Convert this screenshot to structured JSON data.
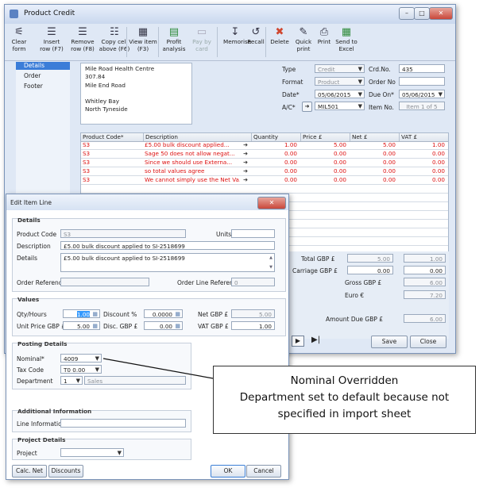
{
  "main_window": {
    "title": "Product Credit",
    "toolbar": [
      {
        "label": "Clear\nform",
        "icon": "broom-icon"
      },
      {
        "label": "Insert\nrow (F7)",
        "icon": "insert-row-icon"
      },
      {
        "label": "Remove\nrow (F8)",
        "icon": "remove-row-icon"
      },
      {
        "label": "Copy cell\nabove (F6)",
        "icon": "copy-cell-icon"
      },
      {
        "label": "View item\n(F3)",
        "icon": "view-item-icon"
      },
      {
        "label": "Profit\nanalysis",
        "icon": "profit-icon"
      },
      {
        "label": "Pay by\ncard",
        "icon": "card-icon",
        "disabled": true
      },
      {
        "label": "Memorise",
        "icon": "memorise-icon"
      },
      {
        "label": "Recall",
        "icon": "recall-icon"
      },
      {
        "label": "Delete",
        "icon": "delete-icon"
      },
      {
        "label": "Quick\nprint",
        "icon": "quick-print-icon"
      },
      {
        "label": "Print",
        "icon": "print-icon"
      },
      {
        "label": "Send to\nExcel",
        "icon": "excel-icon"
      }
    ],
    "nav": [
      "Details",
      "Order",
      "Footer"
    ],
    "address": [
      "Mile Road Health Centre",
      "307.84",
      "Mile End Road",
      "",
      "Whitley Bay",
      "North Tyneside"
    ],
    "type_label": "Type",
    "type_value": "Credit",
    "format_label": "Format",
    "format_value": "Product",
    "date_label": "Date*",
    "date_value": "05/06/2015",
    "ac_label": "A/C*",
    "ac_value": "MIL501",
    "crdno_label": "Crd.No.",
    "crdno_value": "435",
    "orderno_label": "Order No",
    "orderno_value": "",
    "dueon_label": "Due On*",
    "dueon_value": "05/06/2015",
    "itemno_label": "Item No.",
    "itemno_value": "Item 1 of 5",
    "grid_headers": [
      "Product Code*",
      "Description",
      "Quantity",
      "Price £",
      "Net £",
      "VAT £"
    ],
    "grid_rows": [
      {
        "code": "S3",
        "desc": "£5.00 bulk discount applied...",
        "qty": "1.00",
        "price": "5.00",
        "net": "5.00",
        "vat": "1.00"
      },
      {
        "code": "S3",
        "desc": "Sage 50 does not allow negat...",
        "qty": "0.00",
        "price": "0.00",
        "net": "0.00",
        "vat": "0.00"
      },
      {
        "code": "S3",
        "desc": "Since we should use Externa...",
        "qty": "0.00",
        "price": "0.00",
        "net": "0.00",
        "vat": "0.00"
      },
      {
        "code": "S3",
        "desc": "so total values agree",
        "qty": "0.00",
        "price": "0.00",
        "net": "0.00",
        "vat": "0.00"
      },
      {
        "code": "S3",
        "desc": "We cannot simply use the Net Va...",
        "qty": "0.00",
        "price": "0.00",
        "net": "0.00",
        "vat": "0.00"
      }
    ],
    "totals": {
      "total_label": "Total GBP £",
      "total_net": "5.00",
      "total_vat": "1.00",
      "carriage_label": "Carriage GBP £",
      "carriage_net": "0.00",
      "carriage_vat": "0.00",
      "gross_label": "Gross GBP £",
      "gross_value": "6.00",
      "euro_label": "Euro €",
      "euro_value": "7.20",
      "amount_due_label": "Amount Due GBP £",
      "amount_due_value": "6.00"
    },
    "save_label": "Save",
    "close_label": "Close"
  },
  "edit_dialog": {
    "title": "Edit Item Line",
    "details_title": "Details",
    "product_code_label": "Product Code",
    "product_code_value": "S3",
    "units_label": "Units",
    "units_value": "",
    "description_label": "Description",
    "description_value": "£5.00 bulk discount applied to SI-2518699",
    "details_label": "Details",
    "details_value": "£5.00 bulk discount applied to SI-2518699",
    "order_ref_label": "Order Reference",
    "order_ref_value": "",
    "order_line_ref_label": "Order Line Reference",
    "order_line_ref_value": "0",
    "values_title": "Values",
    "qty_label": "Qty/Hours",
    "qty_value": "1.00",
    "discount_pct_label": "Discount %",
    "discount_pct_value": "0.0000",
    "net_label": "Net GBP £",
    "net_value": "5.00",
    "unit_price_label": "Unit Price GBP £",
    "unit_price_value": "5.00",
    "disc_gbp_label": "Disc. GBP £",
    "disc_gbp_value": "0.00",
    "vat_label": "VAT GBP £",
    "vat_value": "1.00",
    "posting_title": "Posting Details",
    "nominal_label": "Nominal*",
    "nominal_value": "4009",
    "taxcode_label": "Tax Code",
    "taxcode_value": "T0 0.00",
    "department_label": "Department",
    "department_value": "1",
    "department_name": "Sales",
    "additional_title": "Additional Information",
    "line_info_label": "Line Information",
    "line_info_value": "",
    "project_title": "Project Details",
    "project_label": "Project",
    "project_value": "",
    "calc_net_label": "Calc. Net",
    "discounts_label": "Discounts",
    "ok_label": "OK",
    "cancel_label": "Cancel"
  },
  "callout": {
    "line1": "Nominal Overridden",
    "line2": "Department set to default because not",
    "line3": "specified in import sheet"
  }
}
